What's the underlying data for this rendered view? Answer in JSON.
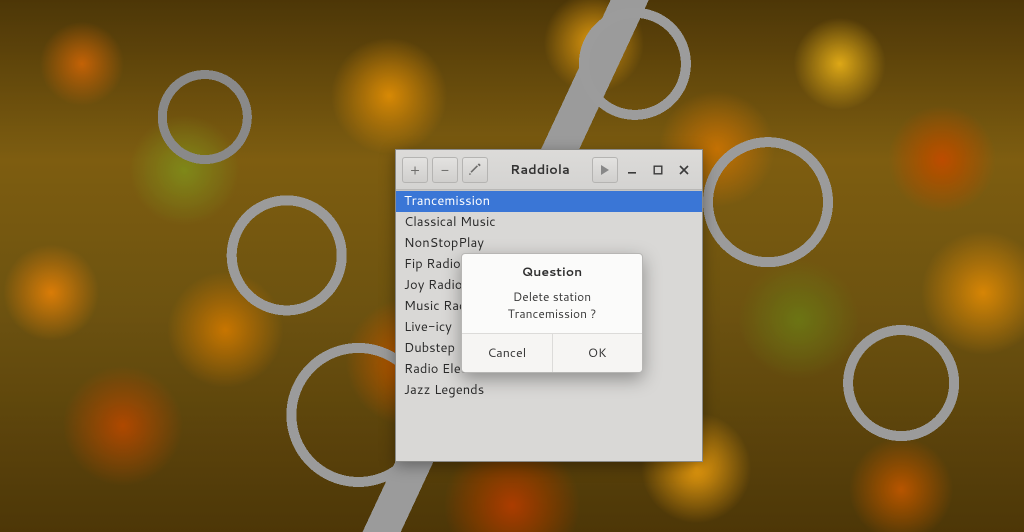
{
  "window": {
    "title": "Raddiola",
    "selected_index": 0,
    "stations": [
      "Trancemission",
      "Classical Music",
      "NonStopPlay",
      "Fip Radio",
      "Joy Radio",
      "Music Radio",
      "Live-icy",
      "Dubstep",
      "Radio Electro",
      "Jazz Legends"
    ]
  },
  "dialog": {
    "title": "Question",
    "message": "Delete station Trancemission ?",
    "cancel": "Cancel",
    "ok": "OK"
  }
}
